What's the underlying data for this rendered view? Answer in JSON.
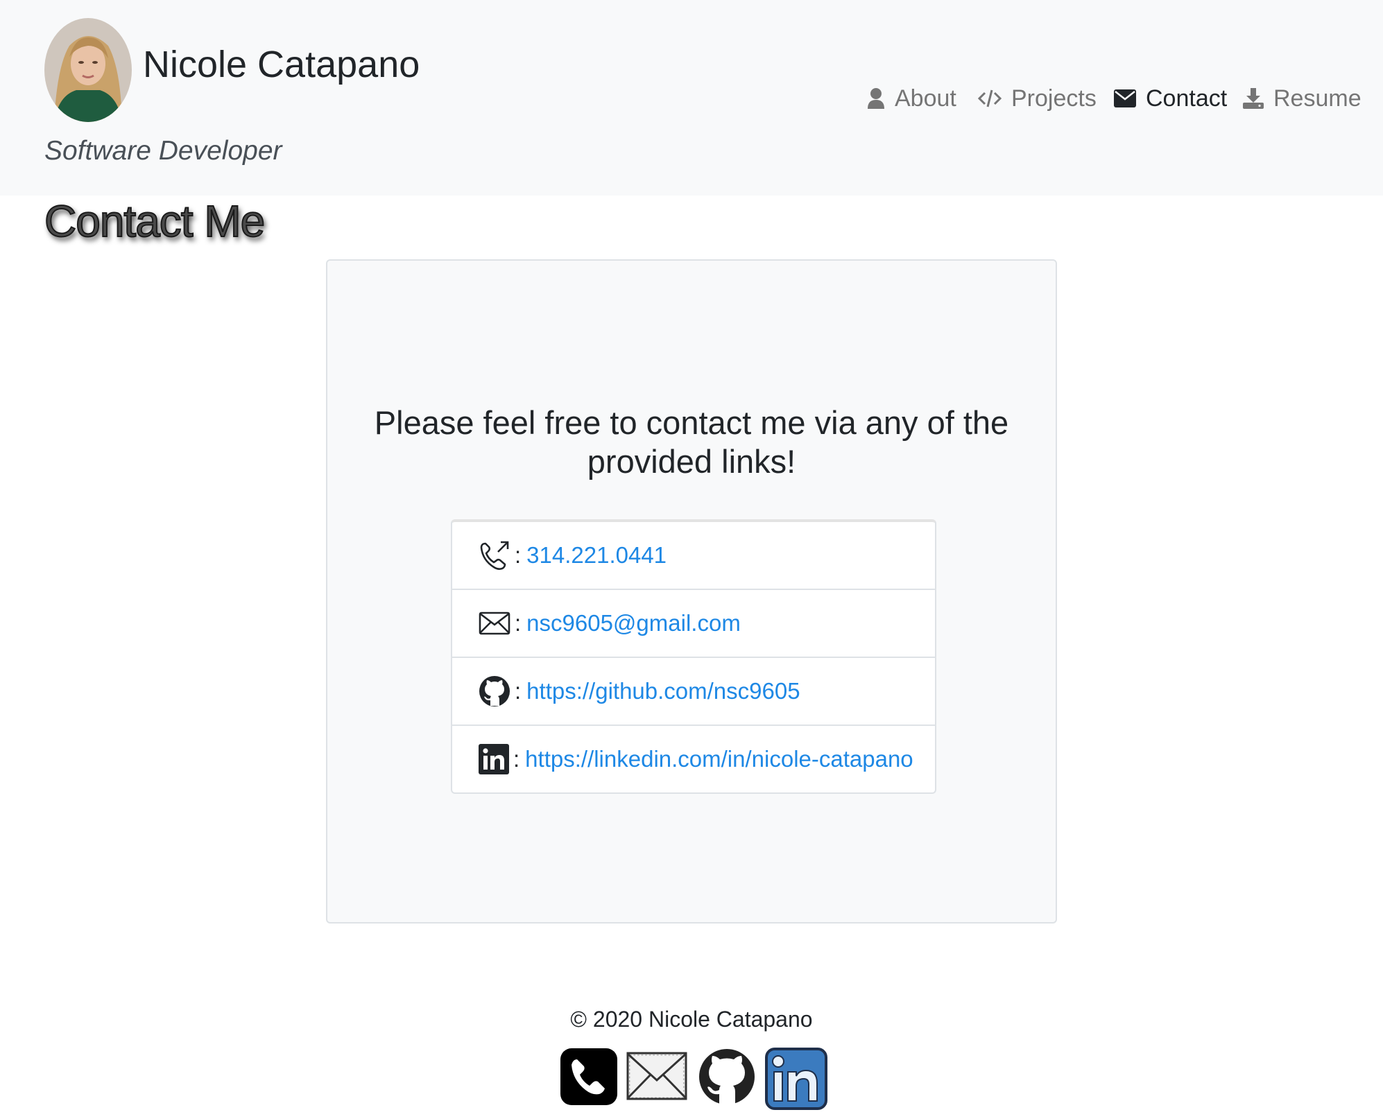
{
  "header": {
    "name": "Nicole Catapano",
    "tagline": "Software Developer"
  },
  "nav": {
    "items": [
      {
        "label": "About",
        "icon": "user-icon"
      },
      {
        "label": "Projects",
        "icon": "code-icon"
      },
      {
        "label": "Contact",
        "icon": "envelope-icon",
        "active": true
      },
      {
        "label": "Resume",
        "icon": "download-icon"
      }
    ]
  },
  "page": {
    "title": "Contact Me"
  },
  "card": {
    "intro_line1": "Please feel free to contact me via any of the",
    "intro_line2": "provided links!",
    "separator": ":",
    "contacts": [
      {
        "icon": "phone-outgoing-icon",
        "value": "314.221.0441"
      },
      {
        "icon": "envelope-icon",
        "value": "nsc9605@gmail.com"
      },
      {
        "icon": "github-icon",
        "value": "https://github.com/nsc9605"
      },
      {
        "icon": "linkedin-icon",
        "value": "https://linkedin.com/in/nicole-catapano"
      }
    ]
  },
  "footer": {
    "copyright": "© 2020 Nicole Catapano",
    "icons": [
      "phone-icon",
      "mail-icon",
      "github-icon",
      "linkedin-icon"
    ]
  },
  "colors": {
    "link": "#1e88e5",
    "header_bg": "#f8f9fa",
    "nav_inactive": "#757575",
    "nav_active": "#212529",
    "linkedin_blue": "#3b7bbf"
  }
}
